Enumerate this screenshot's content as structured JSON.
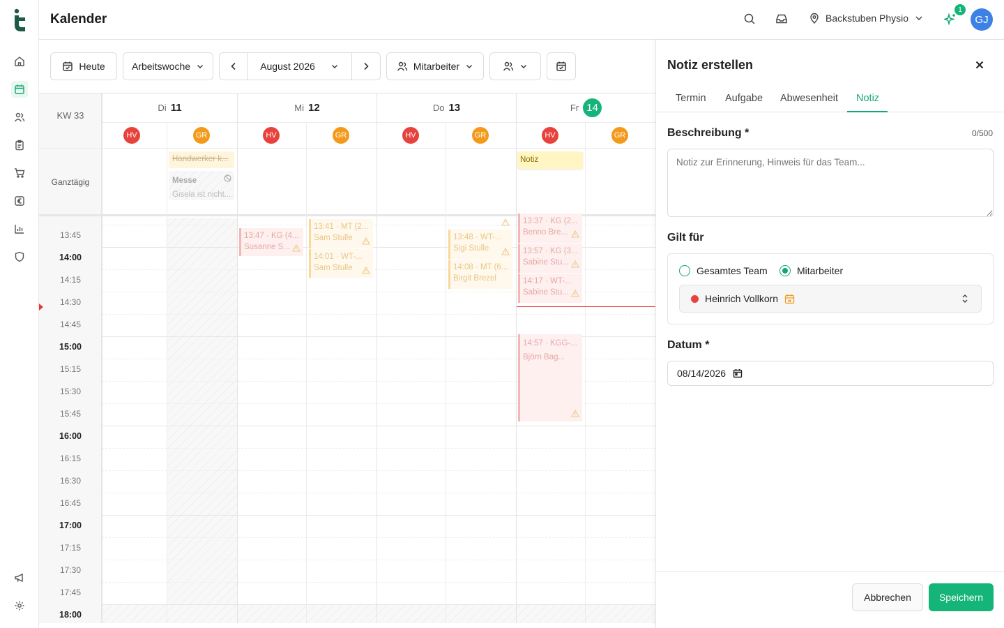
{
  "header": {
    "title": "Kalender",
    "location": "Backstuben Physio",
    "notification_count": "1",
    "user_initials": "GJ"
  },
  "toolbar": {
    "today": "Heute",
    "view": "Arbeitswoche",
    "month": "August 2026",
    "staff": "Mitarbeiter"
  },
  "calendar": {
    "week": "KW 33",
    "allday_label": "Ganztägig",
    "days": [
      {
        "dow": "Di",
        "num": "11"
      },
      {
        "dow": "Mi",
        "num": "12"
      },
      {
        "dow": "Do",
        "num": "13"
      },
      {
        "dow": "Fr",
        "num": "14"
      }
    ],
    "staff": [
      "HV",
      "GR",
      "HV",
      "GR",
      "HV",
      "GR",
      "HV",
      "GR"
    ],
    "allday_events": {
      "handwerker": "Handwerker k...",
      "messe": "Messe",
      "messe_sub": "Gisela ist nicht...",
      "notiz": "Notiz"
    },
    "times": [
      "13:45",
      "14:00",
      "14:15",
      "14:30",
      "14:45",
      "15:00",
      "15:15",
      "15:30",
      "15:45",
      "16:00",
      "16:15",
      "16:30",
      "16:45",
      "17:00",
      "17:15",
      "17:30",
      "17:45",
      "18:00"
    ],
    "events": [
      {
        "t": "13:47 · KG (4...",
        "n": "Susanne S..."
      },
      {
        "t": "13:41 · MT (2...",
        "n": "Sam Stulle"
      },
      {
        "t": "14:01 · WT-...",
        "n": "Sam Stulle"
      },
      {
        "t": "13:48 · WT-...",
        "n": "Sigi Stulle"
      },
      {
        "t": "14:08 · MT (6...",
        "n": "Birgit Brezel"
      },
      {
        "t": "13:37 · KG (2...",
        "n": "Benno Bre..."
      },
      {
        "t": "13:57 · KG (3...",
        "n": "Sabine Stu..."
      },
      {
        "t": "14:17 · WT-...",
        "n": "Sabine Stu..."
      },
      {
        "t": "14:57 · KGG-...",
        "n": "Björn Bag..."
      }
    ]
  },
  "panel": {
    "title": "Notiz erstellen",
    "tabs": [
      "Termin",
      "Aufgabe",
      "Abwesenheit",
      "Notiz"
    ],
    "description_label": "Beschreibung *",
    "counter": "0/500",
    "description_placeholder": "Notiz zur Erinnerung, Hinweis für das Team...",
    "applies_label": "Gilt für",
    "option_team": "Gesamtes Team",
    "option_staff": "Mitarbeiter",
    "selected_staff": "Heinrich Vollkorn",
    "date_label": "Datum *",
    "date_value": "08/14/2026",
    "cancel": "Abbrechen",
    "save": "Speichern"
  },
  "colors": {
    "accent": "#13a872",
    "hv": "#e8423d",
    "gr": "#f39a1c",
    "avatar": "#3d80e6"
  }
}
